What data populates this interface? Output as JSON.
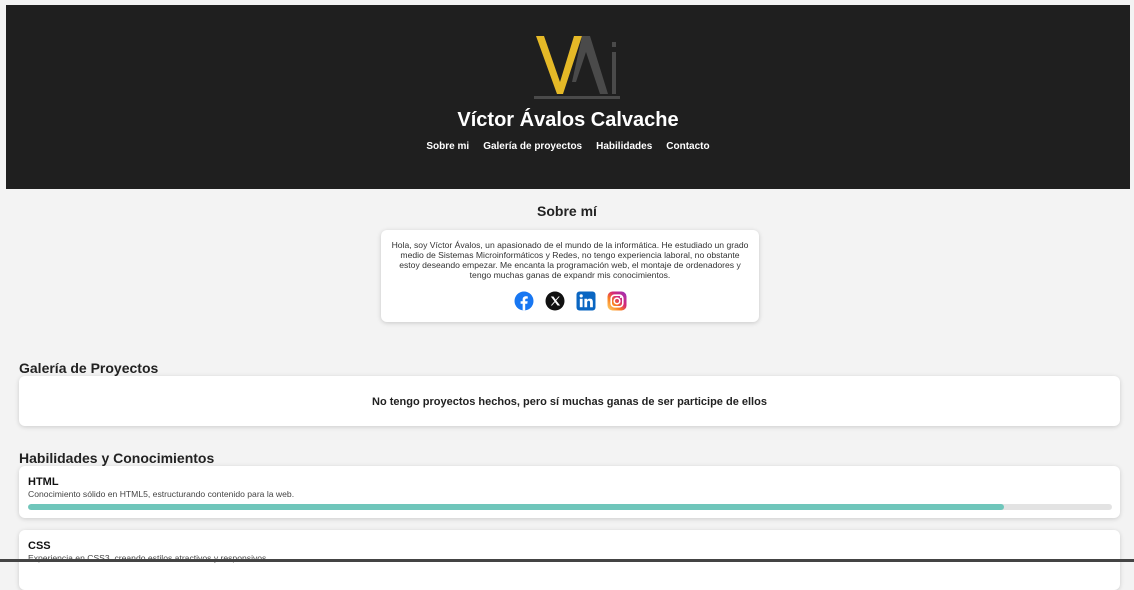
{
  "header": {
    "logo_text": "VAj",
    "site_title": "Víctor Ávalos Calvache",
    "nav": [
      {
        "label": "Sobre mi"
      },
      {
        "label": "Galería de proyectos"
      },
      {
        "label": "Habilidades"
      },
      {
        "label": "Contacto"
      }
    ],
    "background_color": "#1f1f1f",
    "logo_accent_color": "#e5b927"
  },
  "about": {
    "title": "Sobre mí",
    "text": "Hola, soy Víctor Ávalos, un apasionado de el mundo de la informática. He estudiado un grado medio de Sistemas Microinformáticos y Redes, no tengo experiencia laboral, no obstante estoy deseando empezar. Me encanta la programación web, el montaje de ordenadores y tengo muchas ganas de expandr mis conocimientos.",
    "socials": [
      {
        "icon": "facebook-icon"
      },
      {
        "icon": "x-icon"
      },
      {
        "icon": "linkedin-icon"
      },
      {
        "icon": "instagram-icon"
      }
    ]
  },
  "gallery": {
    "title": "Galería de Proyectos",
    "empty_text": "No tengo proyectos hechos, pero sí muchas ganas de ser participe de ellos"
  },
  "skills": {
    "title": "Habilidades y Conocimientos",
    "accent_color": "#6fc6bb",
    "items": [
      {
        "name": "HTML",
        "description": "Conocimiento sólido en HTML5, estructurando contenido para la web.",
        "level_percent": 90
      },
      {
        "name": "CSS",
        "description": "Experiencia en CSS3, creando estilos atractivos y responsivos."
      }
    ]
  }
}
